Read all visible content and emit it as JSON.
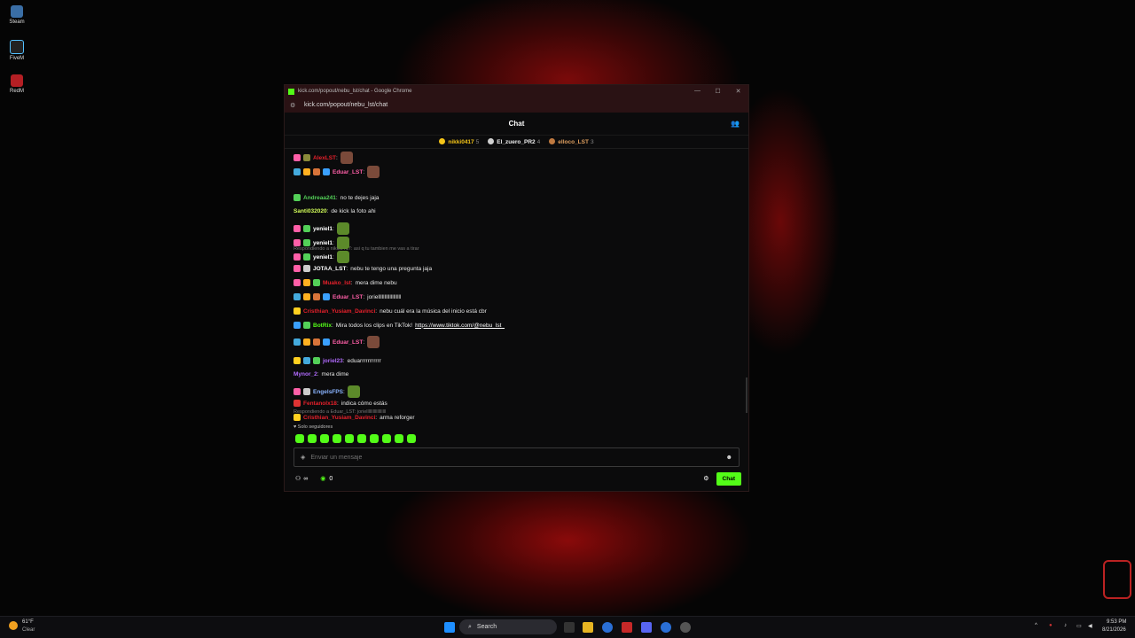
{
  "desktop": {
    "icons": [
      {
        "label": "Steam",
        "color": "#3a6ea5"
      },
      {
        "label": "FiveM",
        "color": "#1a1a1a"
      },
      {
        "label": "RedM",
        "color": "#b41f24"
      }
    ]
  },
  "browser": {
    "title": "kick.com/popout/nebu_lst/chat - Google Chrome",
    "url": "kick.com/popout/nebu_lst/chat"
  },
  "chat": {
    "header": "Chat",
    "top_gifters": [
      {
        "name": "nikki0417",
        "count": "5",
        "color": "#f5c518"
      },
      {
        "name": "El_zuero_PR2",
        "count": "4",
        "color": "#e0e0e0"
      },
      {
        "name": "elloco_LST",
        "count": "3",
        "color": "#e0a060"
      }
    ],
    "messages": [
      {
        "user": "AlexLST",
        "color": "#e6202b",
        "text": "",
        "emote": true
      },
      {
        "user": "Eduar_LST",
        "color": "#ff5fa8",
        "text": "",
        "emote": true
      },
      {
        "user": "Andreaa241",
        "color": "#53d058",
        "text": "no te dejes jaja"
      },
      {
        "user": "Santi032020",
        "color": "#d4ff5a",
        "text": "de kick la foto ahi"
      },
      {
        "user": "yeniel1",
        "color": "#ffffff",
        "text": "",
        "emote": true
      },
      {
        "user": "yeniel1",
        "color": "#ffffff",
        "text": "",
        "emote": true
      },
      {
        "user": "yeniel1",
        "color": "#ffffff",
        "text": "",
        "emote": true
      },
      {
        "user": "JOTAA_LST",
        "color": "#ffffff",
        "text": "nebu te tengo una pregunta jaja"
      },
      {
        "user": "Muako_lst",
        "color": "#e6202b",
        "text": "mera dime nebu"
      },
      {
        "user": "Eduar_LST",
        "color": "#ff5fa8",
        "text": "joriellllllllllllllllll"
      },
      {
        "user": "Cristhian_Yusiam_Davinci",
        "color": "#e6202b",
        "text": "nebu cuál era la música del inicio está cbr"
      },
      {
        "user": "BotRix",
        "color": "#53fc18",
        "text": "Mira todos los clips en TikTok!",
        "link": "https://www.tiktok.com/@nebu_lst_"
      },
      {
        "user": "Eduar_LST",
        "color": "#ff5fa8",
        "text": "",
        "emote": true
      },
      {
        "user": "joriel23",
        "color": "#b26bff",
        "text": "eduarrrrrrrrrrr"
      },
      {
        "user": "Mynor_2",
        "color": "#b26bff",
        "text": "mera dime"
      },
      {
        "user": "EngelsFPS",
        "color": "#8ab4ff",
        "text": "",
        "emote": true
      },
      {
        "user": "Fentanolx18",
        "color": "#e6202b",
        "text": "indica cómo estás"
      },
      {
        "user": "Cristhian_Yusiam_Davinci",
        "color": "#e6202b",
        "text": "arma reforger"
      }
    ],
    "replies": [
      "Respondiendo a nikki0417: asi q tu tambien me vas a tirar",
      "Respondiendo a Eduar_LST: joriellllllllllllllllll"
    ],
    "followers_mode": "Solo seguidores",
    "input_placeholder": "Enviar un mensaje",
    "viewers_icon": "∞",
    "points": "0",
    "send_label": "Chat",
    "scrollbar_level": 0.85
  },
  "taskbar": {
    "weather_temp": "61°F",
    "weather_cond": "Clear",
    "search_label": "Search",
    "time": "9:53 PM",
    "date": "8/21/2026"
  }
}
